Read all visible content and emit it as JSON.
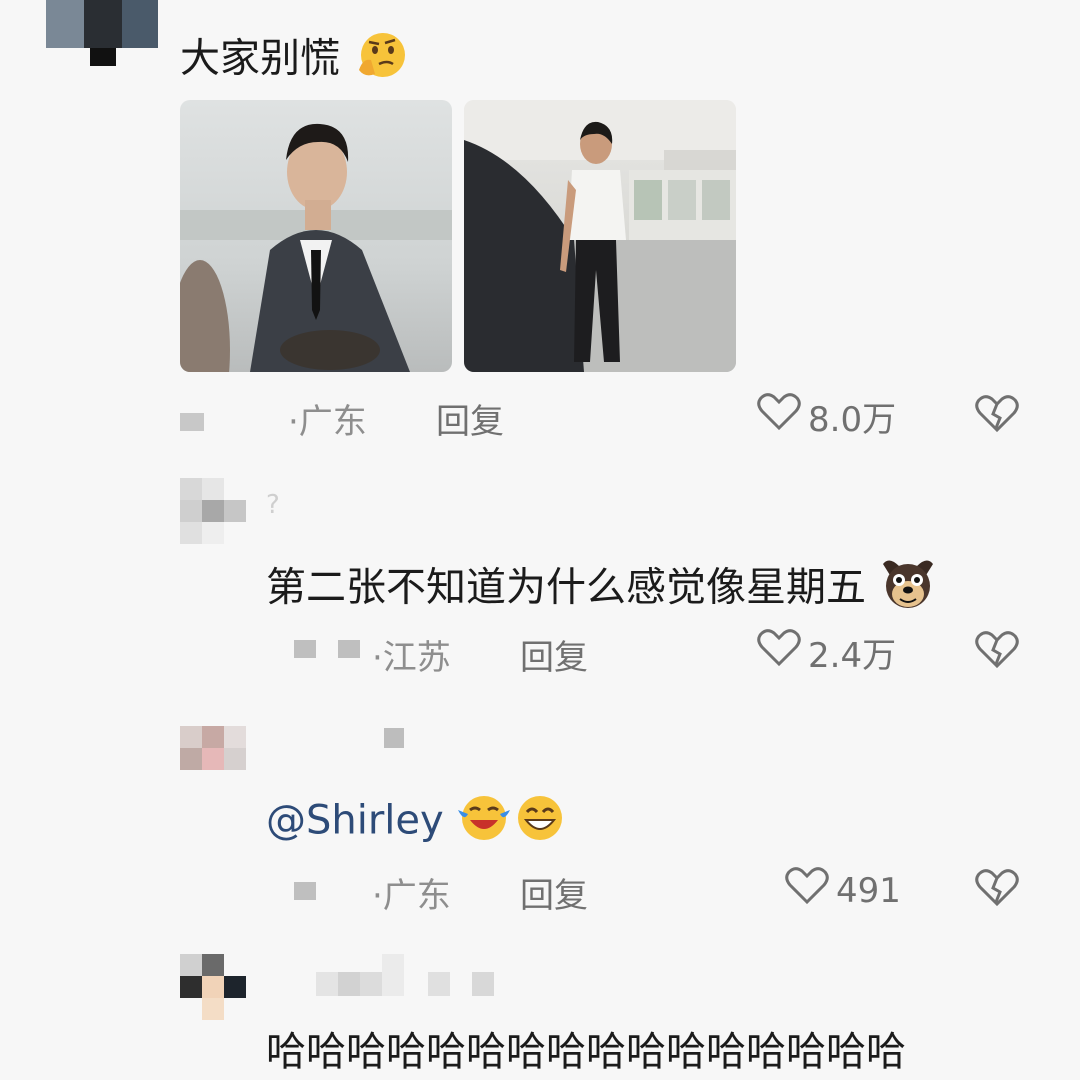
{
  "comments": [
    {
      "text": "大家别慌",
      "emoji": "thinking-face-icon",
      "location": "·广东",
      "reply": "回复",
      "likes": "8.0万",
      "images": [
        {
          "description_name": "man-in-suit-photo"
        },
        {
          "description_name": "man-in-parking-garage-photo"
        }
      ]
    },
    {
      "avatar_extra": "?",
      "text": "第二张不知道为什么感觉像星期五",
      "emoji": "dog-face-icon",
      "location": "·江苏",
      "reply": "回复",
      "likes": "2.4万"
    },
    {
      "mention": "@Shirley",
      "emojis": [
        "laughing-tears-icon",
        "grinning-face-icon"
      ],
      "location": "·广东",
      "reply": "回复",
      "likes": "491"
    },
    {
      "text": "哈哈哈哈哈哈哈哈哈哈哈哈哈哈哈哈"
    }
  ],
  "colors": {
    "background": "#f7f7f7",
    "mention": "#2d4b78",
    "meta": "#8e8e8e"
  }
}
